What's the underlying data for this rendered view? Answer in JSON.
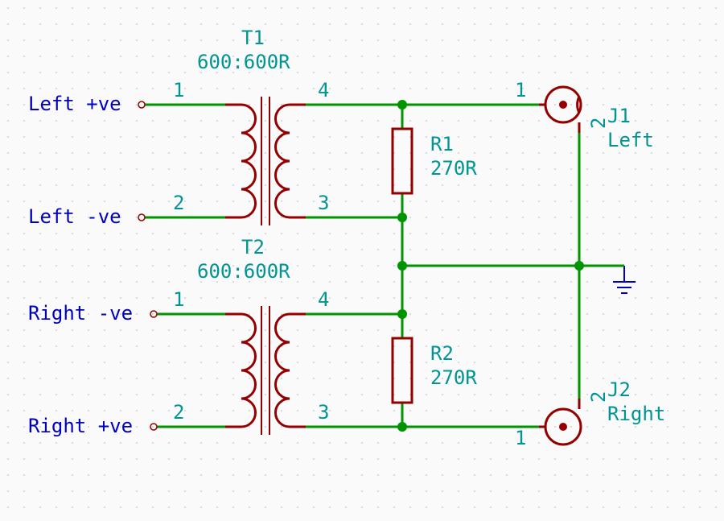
{
  "netlabels": {
    "left_pos": "Left +ve",
    "left_neg": "Left -ve",
    "right_neg": "Right -ve",
    "right_pos": "Right +ve"
  },
  "components": {
    "T1": {
      "ref": "T1",
      "value": "600:600R",
      "pins": {
        "p1": "1",
        "p2": "2",
        "p3": "3",
        "p4": "4"
      }
    },
    "T2": {
      "ref": "T2",
      "value": "600:600R",
      "pins": {
        "p1": "1",
        "p2": "2",
        "p3": "3",
        "p4": "4"
      }
    },
    "R1": {
      "ref": "R1",
      "value": "270R"
    },
    "R2": {
      "ref": "R2",
      "value": "270R"
    },
    "J1": {
      "ref": "J1",
      "value": "Left",
      "pins": {
        "p1": "1",
        "p2": "2"
      }
    },
    "J2": {
      "ref": "J2",
      "value": "Right",
      "pins": {
        "p1": "1",
        "p2": "2"
      }
    }
  },
  "colors": {
    "component": "#940000",
    "wire": "#009400",
    "refvalue": "#009494",
    "netlabel": "#0000c0",
    "grid_bg": "#fafafa"
  }
}
